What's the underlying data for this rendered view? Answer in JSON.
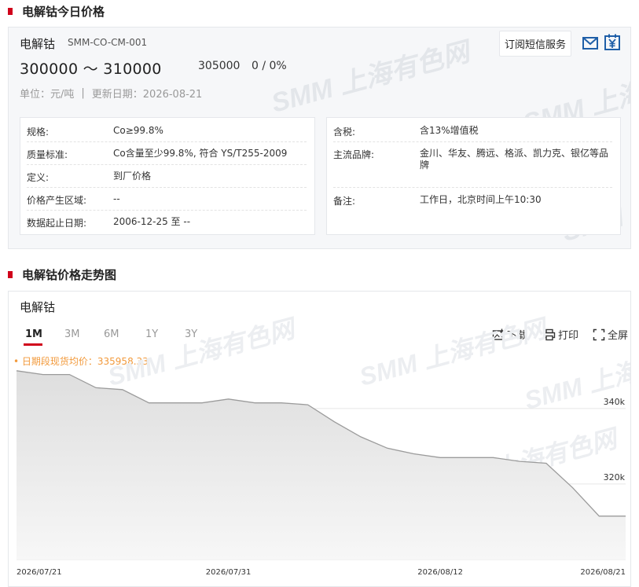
{
  "section1": {
    "title": "电解钴今日价格"
  },
  "product": {
    "name": "电解钴",
    "code": "SMM-CO-CM-001",
    "price_range": "300000 ～ 310000",
    "avg_price": "305000",
    "change": "0 / 0%",
    "unit": "单位：元/吨",
    "separator": "|",
    "updated": "更新日期：2026-08-21",
    "subscribe_label": "订阅短信服务"
  },
  "watermark": "SMM 上海有色网",
  "spec_left": [
    {
      "k": "规格:",
      "v": "Co≥99.8%"
    },
    {
      "k": "质量标准:",
      "v": "Co含量至少99.8%, 符合 YS/T255-2009"
    },
    {
      "k": "定义:",
      "v": "到厂价格"
    },
    {
      "k": "价格产生区域:",
      "v": "--"
    },
    {
      "k": "数据起止日期:",
      "v": "2006-12-25 至 --"
    }
  ],
  "spec_right": [
    {
      "k": "含税:",
      "v": "含13%增值税"
    },
    {
      "k": "主流品牌:",
      "v": "金川、华友、腾远、格派、凯力克、银亿等品牌"
    },
    {
      "k": "备注:",
      "v": "工作日，北京时间上午10:30"
    }
  ],
  "section2": {
    "title": "电解钴价格走势图"
  },
  "chart_panel": {
    "name": "电解钴",
    "tabs": [
      "1M",
      "3M",
      "6M",
      "1Y",
      "3Y"
    ],
    "active_tab": "1M",
    "tools": {
      "download": "下载",
      "print": "打印",
      "fullscreen": "全屏"
    },
    "avg_note": "• 日期段现货均价：335958.33"
  },
  "colors": {
    "accent": "#d0021b",
    "avg_note": "#f29a3c",
    "line": "#9b9b9b"
  },
  "chart_data": {
    "type": "area",
    "title": "电解钴",
    "x": [
      "2026/07/21",
      "2026/07/22",
      "2026/07/23",
      "2026/07/24",
      "2026/07/27",
      "2026/07/28",
      "2026/07/29",
      "2026/07/30",
      "2026/07/31",
      "2026/08/03",
      "2026/08/04",
      "2026/08/05",
      "2026/08/06",
      "2026/08/07",
      "2026/08/10",
      "2026/08/11",
      "2026/08/12",
      "2026/08/13",
      "2026/08/14",
      "2026/08/17",
      "2026/08/18",
      "2026/08/19",
      "2026/08/20",
      "2026/08/21"
    ],
    "series": [
      {
        "values": [
          350000,
          349000,
          349000,
          345500,
          345000,
          341500,
          341500,
          341500,
          342500,
          341500,
          341500,
          341000,
          336500,
          332500,
          329500,
          328000,
          327000,
          327000,
          327000,
          326000,
          325500,
          319000,
          311500,
          311500
        ]
      }
    ],
    "x_tick_labels": [
      "2026/07/21",
      "2026/07/31",
      "2026/08/12",
      "2026/08/21"
    ],
    "y_ticks": [
      300000,
      320000,
      340000
    ],
    "y_tick_labels": [
      "300k",
      "320k",
      "340k"
    ],
    "ylim": [
      300000,
      356000
    ],
    "grid": true,
    "legend": "none"
  }
}
